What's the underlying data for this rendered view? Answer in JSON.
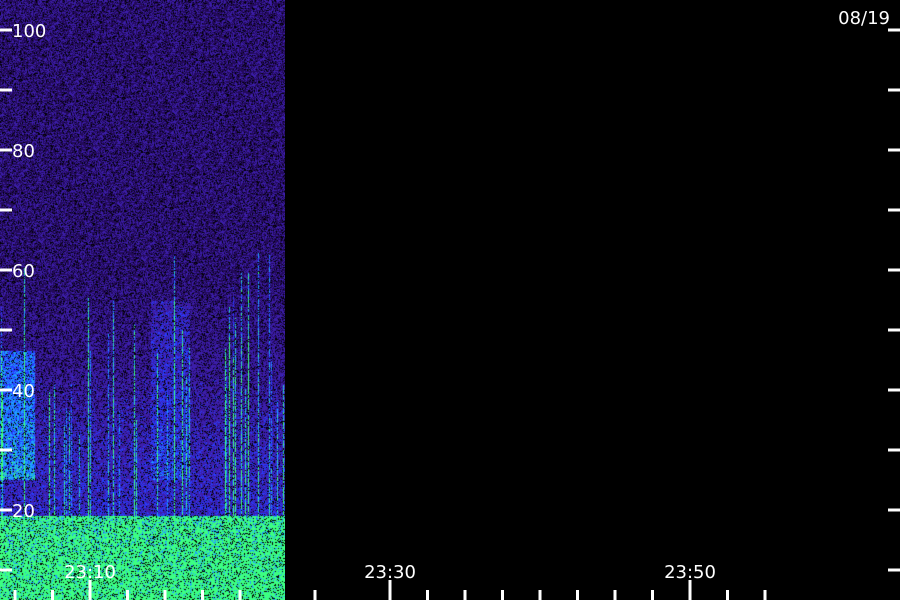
{
  "chart_data": {
    "type": "heatmap",
    "title": "",
    "date_label": "08/19",
    "xlabel": "",
    "ylabel": "",
    "ylim": [
      0,
      105
    ],
    "y_labeled_ticks": [
      20,
      40,
      60,
      80,
      100
    ],
    "y_ticks": [
      0,
      10,
      20,
      30,
      40,
      50,
      60,
      70,
      80,
      90,
      100
    ],
    "x_range_minutes": [
      "23:04",
      "23:64"
    ],
    "x_labeled_ticks": [
      {
        "label": "23:10",
        "minute": 10
      },
      {
        "label": "23:30",
        "minute": 30
      },
      {
        "label": "23:50",
        "minute": 50
      }
    ],
    "x_minor_ticks": [
      5,
      7.5,
      10,
      12.5,
      15,
      17.5,
      20,
      25,
      30,
      32.5,
      35,
      37.5,
      40,
      42.5,
      45,
      47.5,
      50,
      52.5,
      55
    ],
    "data_end_minute": 23,
    "colorscale": [
      "#000000",
      "#1a0050",
      "#3a1aa0",
      "#2a3cff",
      "#20a0ff",
      "#40ff80"
    ],
    "grid": false
  }
}
